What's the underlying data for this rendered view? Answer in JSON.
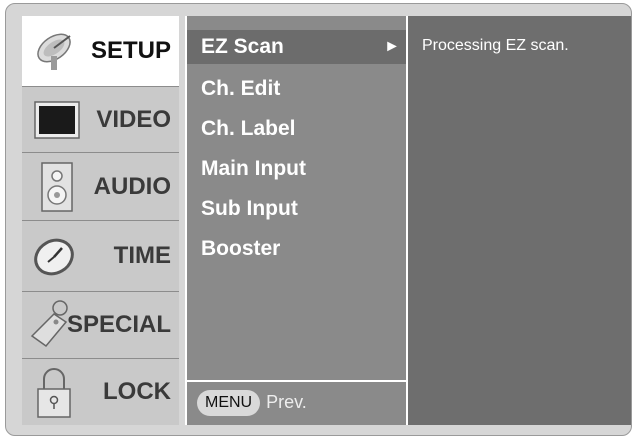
{
  "main_menu": {
    "items": [
      {
        "label": "SETUP",
        "icon": "satellite-dish-icon",
        "selected": true
      },
      {
        "label": "VIDEO",
        "icon": "tv-screen-icon",
        "selected": false
      },
      {
        "label": "AUDIO",
        "icon": "speaker-icon",
        "selected": false
      },
      {
        "label": "TIME",
        "icon": "clock-icon",
        "selected": false
      },
      {
        "label": "SPECIAL",
        "icon": "tag-icon",
        "selected": false
      },
      {
        "label": "LOCK",
        "icon": "padlock-icon",
        "selected": false
      }
    ]
  },
  "submenu": {
    "items": [
      {
        "label": "EZ Scan",
        "selected": true,
        "arrow": "►"
      },
      {
        "label": "Ch. Edit",
        "selected": false
      },
      {
        "label": "Ch. Label",
        "selected": false
      },
      {
        "label": "Main Input",
        "selected": false
      },
      {
        "label": "Sub Input",
        "selected": false
      },
      {
        "label": "Booster",
        "selected": false
      }
    ],
    "footer": {
      "button": "MENU",
      "label": "Prev."
    }
  },
  "detail": {
    "message": "Processing EZ scan."
  },
  "colors": {
    "frame": "#d6d6d6",
    "left_column": "#c9c9c9",
    "selected_item": "#ffffff",
    "submenu_bg": "#8a8a8a",
    "submenu_selected": "#6c6c6c",
    "detail_bg": "#6e6e6e"
  }
}
